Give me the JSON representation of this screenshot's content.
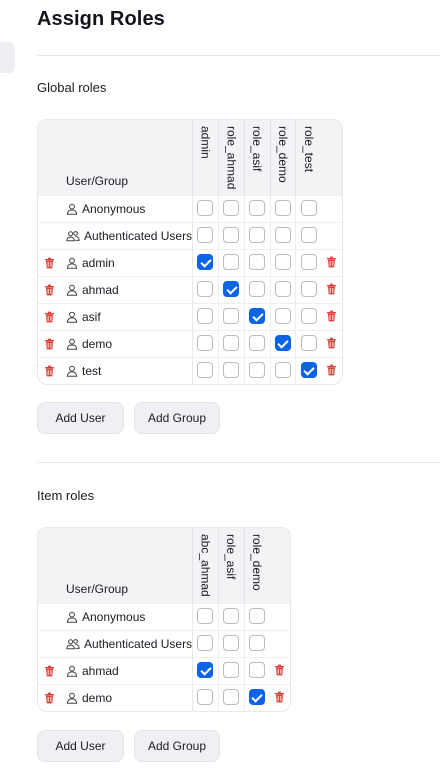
{
  "page": {
    "title": "Assign Roles"
  },
  "global": {
    "section_title": "Global roles",
    "column_header": "User/Group",
    "roles": [
      "admin",
      "role_ahmad",
      "role_asif",
      "role_demo",
      "role_test"
    ],
    "rows": [
      {
        "name": "Anonymous",
        "type": "user",
        "deletable": false,
        "checked": [
          false,
          false,
          false,
          false,
          false
        ]
      },
      {
        "name": "Authenticated Users",
        "type": "group",
        "deletable": false,
        "checked": [
          false,
          false,
          false,
          false,
          false
        ]
      },
      {
        "name": "admin",
        "type": "user",
        "deletable": true,
        "checked": [
          true,
          false,
          false,
          false,
          false
        ]
      },
      {
        "name": "ahmad",
        "type": "user",
        "deletable": true,
        "checked": [
          false,
          true,
          false,
          false,
          false
        ]
      },
      {
        "name": "asif",
        "type": "user",
        "deletable": true,
        "checked": [
          false,
          false,
          true,
          false,
          false
        ]
      },
      {
        "name": "demo",
        "type": "user",
        "deletable": true,
        "checked": [
          false,
          false,
          false,
          true,
          false
        ]
      },
      {
        "name": "test",
        "type": "user",
        "deletable": true,
        "checked": [
          false,
          false,
          false,
          false,
          true
        ]
      }
    ],
    "add_user_label": "Add User",
    "add_group_label": "Add Group"
  },
  "item": {
    "section_title": "Item roles",
    "column_header": "User/Group",
    "roles": [
      "abc_ahmad",
      "role_asif",
      "role_demo"
    ],
    "rows": [
      {
        "name": "Anonymous",
        "type": "user",
        "deletable": false,
        "checked": [
          false,
          false,
          false
        ]
      },
      {
        "name": "Authenticated Users",
        "type": "group",
        "deletable": false,
        "checked": [
          false,
          false,
          false
        ]
      },
      {
        "name": "ahmad",
        "type": "user",
        "deletable": true,
        "checked": [
          true,
          false,
          false
        ]
      },
      {
        "name": "demo",
        "type": "user",
        "deletable": true,
        "checked": [
          false,
          false,
          true
        ]
      }
    ],
    "add_user_label": "Add User",
    "add_group_label": "Add Group"
  },
  "colors": {
    "accent": "#0b63e5",
    "danger": "#e0403a"
  }
}
